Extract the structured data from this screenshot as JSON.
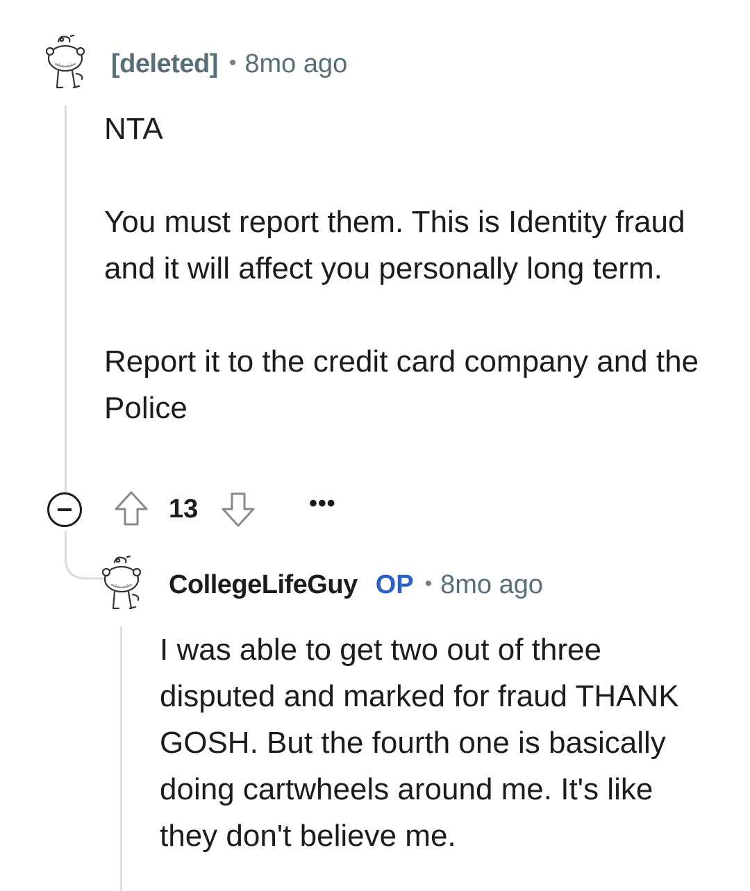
{
  "comments": [
    {
      "author": "[deleted]",
      "separator": "•",
      "time": "8mo ago",
      "paragraphs": [
        "NTA",
        "You must report them. This is Identity fraud and it will affect you personally long term.",
        "Report it to the credit card company and the Police"
      ],
      "score": "13",
      "more_label": "•••"
    },
    {
      "author": "CollegeLifeGuy",
      "op_tag": "OP",
      "separator": "•",
      "time": "8mo ago",
      "paragraphs": [
        "I was able to get two out of three disputed and marked for fraud THANK GOSH. But the fourth one is basically doing cartwheels around me. It's like they don't believe me."
      ]
    }
  ],
  "icons": {
    "avatar": "snoo-avatar-icon",
    "collapse": "collapse-minus-icon",
    "upvote": "upvote-arrow-icon",
    "downvote": "downvote-arrow-icon"
  },
  "colors": {
    "op_tag": "#2a62c9",
    "meta": "#576f76",
    "thread_line": "#dcdcdc"
  }
}
